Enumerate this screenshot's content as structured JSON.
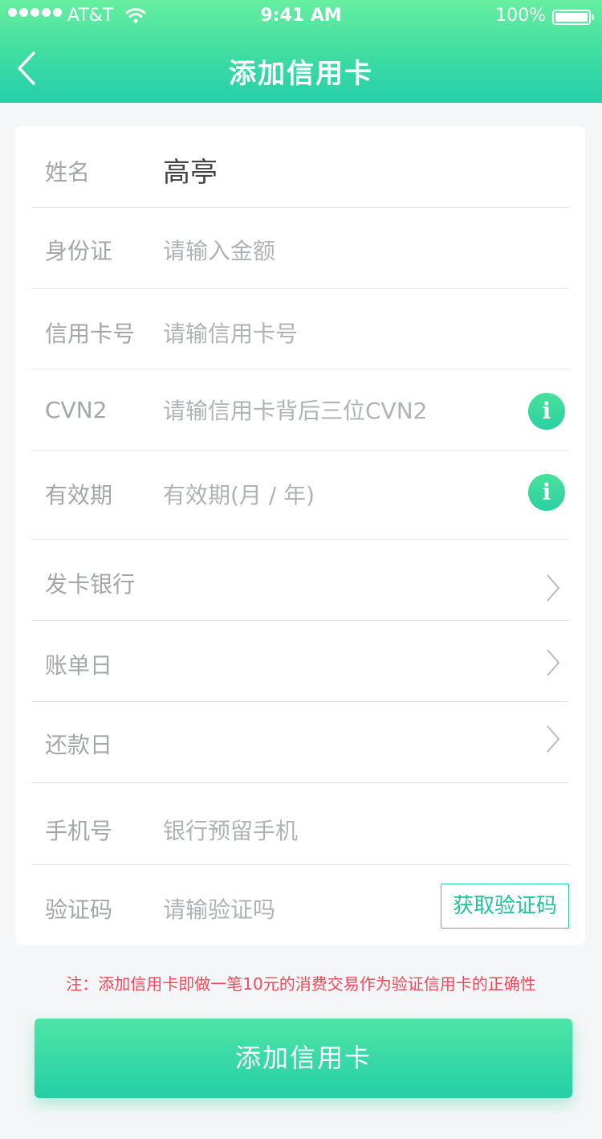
{
  "status_bar": {
    "carrier": "AT&T",
    "time": "9:41 AM",
    "battery": "100%"
  },
  "nav": {
    "title": "添加信用卡",
    "back_icon": "chevron-left-icon"
  },
  "form": {
    "name": {
      "label": "姓名",
      "value": "高亭"
    },
    "id_card": {
      "label": "身份证",
      "placeholder": "请输入金额"
    },
    "card_number": {
      "label": "信用卡号",
      "placeholder": "请输信用卡号"
    },
    "cvn2": {
      "label": "CVN2",
      "placeholder": "请输信用卡背后三位CVN2",
      "info_icon": "i"
    },
    "expiry": {
      "label": "有效期",
      "placeholder": "有效期(月 / 年)",
      "info_icon": "i"
    },
    "bank": {
      "label": "发卡银行"
    },
    "bill_day": {
      "label": "账单日"
    },
    "repay_day": {
      "label": "还款日"
    },
    "phone": {
      "label": "手机号",
      "placeholder": "银行预留手机"
    },
    "verify_code": {
      "label": "验证码",
      "placeholder": "请输验证吗",
      "button": "获取验证码"
    }
  },
  "note": "注：添加信用卡即做一笔10元的消费交易作为验证信用卡的正确性",
  "submit_label": "添加信用卡",
  "colors": {
    "accent": "#2ccfa4",
    "header_top": "#67ef9f",
    "warning": "#f04a5e"
  }
}
